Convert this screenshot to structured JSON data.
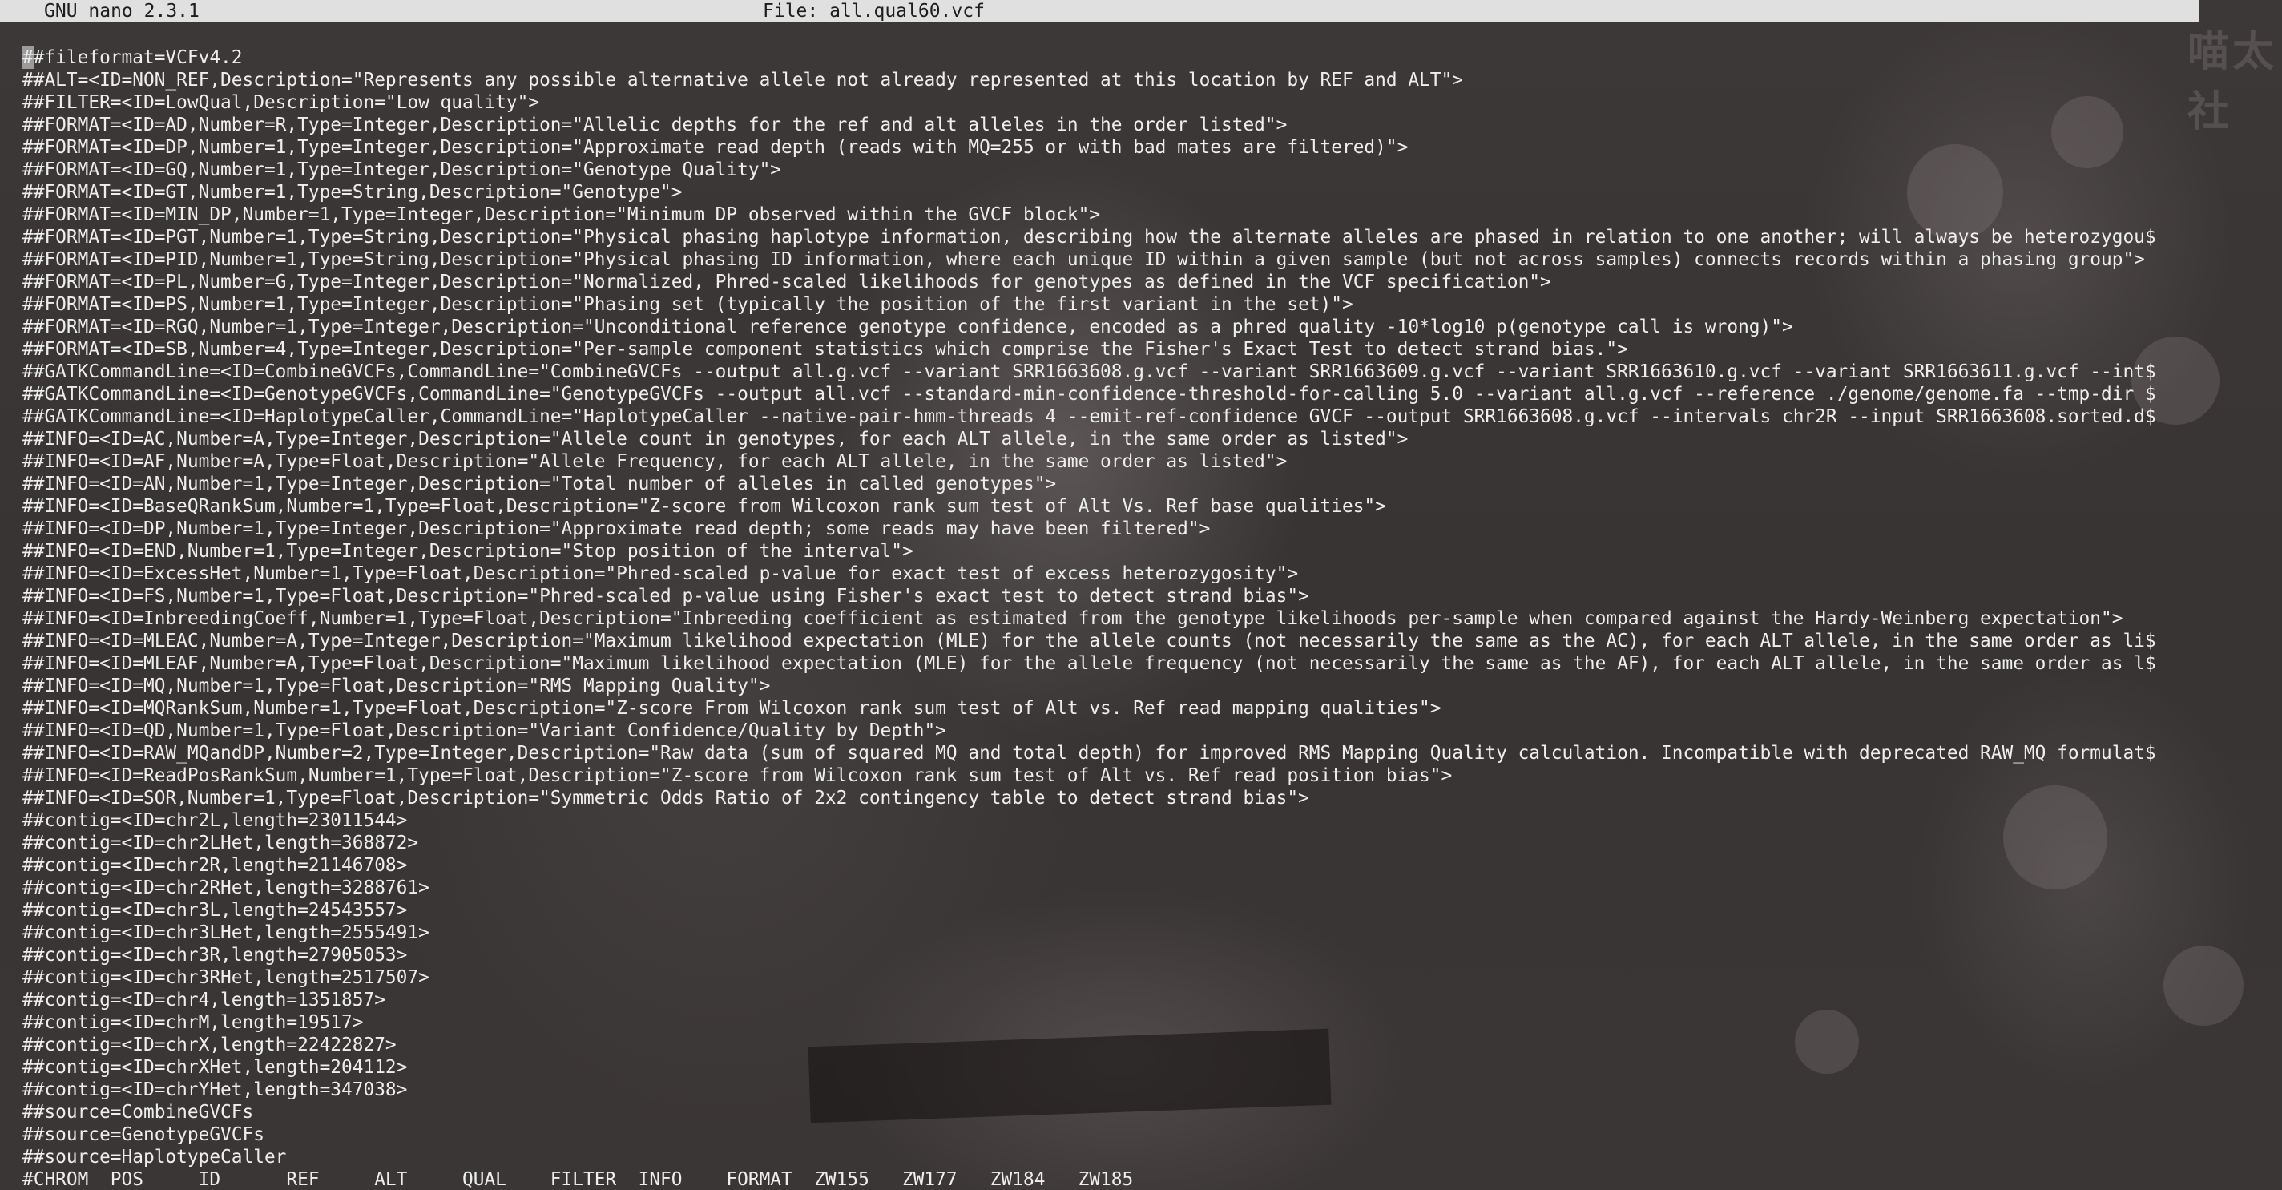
{
  "window": {
    "app_version": "GNU nano 2.3.1",
    "file_label": "File: all.qual60.vcf"
  },
  "watermark": "喵太社",
  "file_lines": [
    "##fileformat=VCFv4.2",
    "##ALT=<ID=NON_REF,Description=\"Represents any possible alternative allele not already represented at this location by REF and ALT\">",
    "##FILTER=<ID=LowQual,Description=\"Low quality\">",
    "##FORMAT=<ID=AD,Number=R,Type=Integer,Description=\"Allelic depths for the ref and alt alleles in the order listed\">",
    "##FORMAT=<ID=DP,Number=1,Type=Integer,Description=\"Approximate read depth (reads with MQ=255 or with bad mates are filtered)\">",
    "##FORMAT=<ID=GQ,Number=1,Type=Integer,Description=\"Genotype Quality\">",
    "##FORMAT=<ID=GT,Number=1,Type=String,Description=\"Genotype\">",
    "##FORMAT=<ID=MIN_DP,Number=1,Type=Integer,Description=\"Minimum DP observed within the GVCF block\">",
    "##FORMAT=<ID=PGT,Number=1,Type=String,Description=\"Physical phasing haplotype information, describing how the alternate alleles are phased in relation to one another; will always be heterozygou$",
    "##FORMAT=<ID=PID,Number=1,Type=String,Description=\"Physical phasing ID information, where each unique ID within a given sample (but not across samples) connects records within a phasing group\">",
    "##FORMAT=<ID=PL,Number=G,Type=Integer,Description=\"Normalized, Phred-scaled likelihoods for genotypes as defined in the VCF specification\">",
    "##FORMAT=<ID=PS,Number=1,Type=Integer,Description=\"Phasing set (typically the position of the first variant in the set)\">",
    "##FORMAT=<ID=RGQ,Number=1,Type=Integer,Description=\"Unconditional reference genotype confidence, encoded as a phred quality -10*log10 p(genotype call is wrong)\">",
    "##FORMAT=<ID=SB,Number=4,Type=Integer,Description=\"Per-sample component statistics which comprise the Fisher's Exact Test to detect strand bias.\">",
    "##GATKCommandLine=<ID=CombineGVCFs,CommandLine=\"CombineGVCFs --output all.g.vcf --variant SRR1663608.g.vcf --variant SRR1663609.g.vcf --variant SRR1663610.g.vcf --variant SRR1663611.g.vcf --int$",
    "##GATKCommandLine=<ID=GenotypeGVCFs,CommandLine=\"GenotypeGVCFs --output all.vcf --standard-min-confidence-threshold-for-calling 5.0 --variant all.g.vcf --reference ./genome/genome.fa --tmp-dir $",
    "##GATKCommandLine=<ID=HaplotypeCaller,CommandLine=\"HaplotypeCaller --native-pair-hmm-threads 4 --emit-ref-confidence GVCF --output SRR1663608.g.vcf --intervals chr2R --input SRR1663608.sorted.d$",
    "##INFO=<ID=AC,Number=A,Type=Integer,Description=\"Allele count in genotypes, for each ALT allele, in the same order as listed\">",
    "##INFO=<ID=AF,Number=A,Type=Float,Description=\"Allele Frequency, for each ALT allele, in the same order as listed\">",
    "##INFO=<ID=AN,Number=1,Type=Integer,Description=\"Total number of alleles in called genotypes\">",
    "##INFO=<ID=BaseQRankSum,Number=1,Type=Float,Description=\"Z-score from Wilcoxon rank sum test of Alt Vs. Ref base qualities\">",
    "##INFO=<ID=DP,Number=1,Type=Integer,Description=\"Approximate read depth; some reads may have been filtered\">",
    "##INFO=<ID=END,Number=1,Type=Integer,Description=\"Stop position of the interval\">",
    "##INFO=<ID=ExcessHet,Number=1,Type=Float,Description=\"Phred-scaled p-value for exact test of excess heterozygosity\">",
    "##INFO=<ID=FS,Number=1,Type=Float,Description=\"Phred-scaled p-value using Fisher's exact test to detect strand bias\">",
    "##INFO=<ID=InbreedingCoeff,Number=1,Type=Float,Description=\"Inbreeding coefficient as estimated from the genotype likelihoods per-sample when compared against the Hardy-Weinberg expectation\">",
    "##INFO=<ID=MLEAC,Number=A,Type=Integer,Description=\"Maximum likelihood expectation (MLE) for the allele counts (not necessarily the same as the AC), for each ALT allele, in the same order as li$",
    "##INFO=<ID=MLEAF,Number=A,Type=Float,Description=\"Maximum likelihood expectation (MLE) for the allele frequency (not necessarily the same as the AF), for each ALT allele, in the same order as l$",
    "##INFO=<ID=MQ,Number=1,Type=Float,Description=\"RMS Mapping Quality\">",
    "##INFO=<ID=MQRankSum,Number=1,Type=Float,Description=\"Z-score From Wilcoxon rank sum test of Alt vs. Ref read mapping qualities\">",
    "##INFO=<ID=QD,Number=1,Type=Float,Description=\"Variant Confidence/Quality by Depth\">",
    "##INFO=<ID=RAW_MQandDP,Number=2,Type=Integer,Description=\"Raw data (sum of squared MQ and total depth) for improved RMS Mapping Quality calculation. Incompatible with deprecated RAW_MQ formulat$",
    "##INFO=<ID=ReadPosRankSum,Number=1,Type=Float,Description=\"Z-score from Wilcoxon rank sum test of Alt vs. Ref read position bias\">",
    "##INFO=<ID=SOR,Number=1,Type=Float,Description=\"Symmetric Odds Ratio of 2x2 contingency table to detect strand bias\">",
    "##contig=<ID=chr2L,length=23011544>",
    "##contig=<ID=chr2LHet,length=368872>",
    "##contig=<ID=chr2R,length=21146708>",
    "##contig=<ID=chr2RHet,length=3288761>",
    "##contig=<ID=chr3L,length=24543557>",
    "##contig=<ID=chr3LHet,length=2555491>",
    "##contig=<ID=chr3R,length=27905053>",
    "##contig=<ID=chr3RHet,length=2517507>",
    "##contig=<ID=chr4,length=1351857>",
    "##contig=<ID=chrM,length=19517>",
    "##contig=<ID=chrX,length=22422827>",
    "##contig=<ID=chrXHet,length=204112>",
    "##contig=<ID=chrYHet,length=347038>",
    "##source=CombineGVCFs",
    "##source=GenotypeGVCFs",
    "##source=HaplotypeCaller",
    "#CHROM  POS     ID      REF     ALT     QUAL    FILTER  INFO    FORMAT  ZW155   ZW177   ZW184   ZW185"
  ],
  "colors": {
    "title_bar_bg": "#e0e0e0",
    "title_bar_fg": "#1e1e1e",
    "text": "#eeeeee",
    "background": "#3a3636"
  }
}
